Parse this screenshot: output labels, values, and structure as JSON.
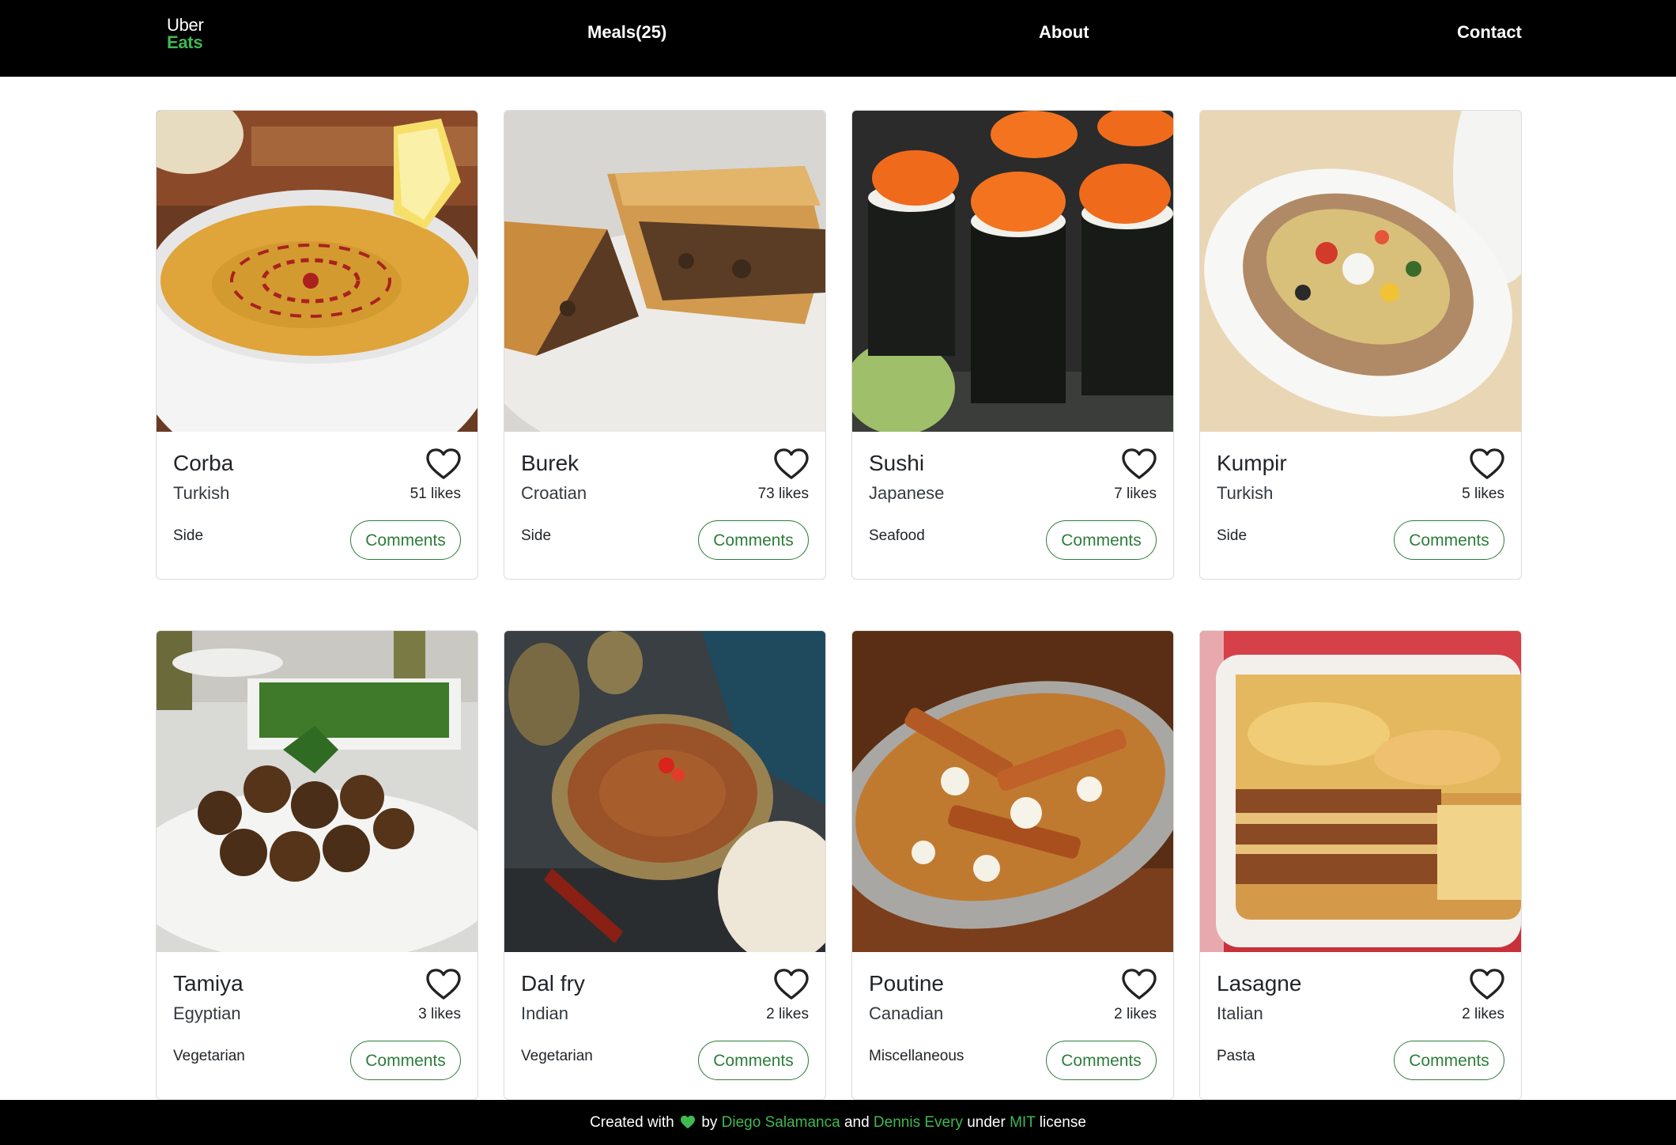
{
  "header": {
    "logo_top": "Uber",
    "logo_bottom": "Eats",
    "nav": {
      "meals": "Meals(25)",
      "about": "About",
      "contact": "Contact"
    }
  },
  "colors": {
    "brand_green": "#3fb950",
    "button_green": "#2e7d3a",
    "navbar_bg": "#000000"
  },
  "meals": [
    {
      "name": "Corba",
      "area": "Turkish",
      "category": "Side",
      "likes": "51 likes",
      "comments_label": "Comments",
      "image": "lentil-soup-in-white-bowl-with-lemon"
    },
    {
      "name": "Burek",
      "area": "Croatian",
      "category": "Side",
      "likes": "73 likes",
      "comments_label": "Comments",
      "image": "meat-filled-pastry-on-plate"
    },
    {
      "name": "Sushi",
      "area": "Japanese",
      "category": "Seafood",
      "likes": "7 likes",
      "comments_label": "Comments",
      "image": "sushi-rolls-with-orange-roe"
    },
    {
      "name": "Kumpir",
      "area": "Turkish",
      "category": "Side",
      "likes": "5 likes",
      "comments_label": "Comments",
      "image": "stuffed-baked-potato"
    },
    {
      "name": "Tamiya",
      "area": "Egyptian",
      "category": "Vegetarian",
      "likes": "3 likes",
      "comments_label": "Comments",
      "image": "falafel-with-salad"
    },
    {
      "name": "Dal fry",
      "area": "Indian",
      "category": "Vegetarian",
      "likes": "2 likes",
      "comments_label": "Comments",
      "image": "lentil-dal-in-brass-bowl-with-naan"
    },
    {
      "name": "Poutine",
      "area": "Canadian",
      "category": "Miscellaneous",
      "likes": "2 likes",
      "comments_label": "Comments",
      "image": "fries-with-gravy-and-cheese-curds"
    },
    {
      "name": "Lasagne",
      "area": "Italian",
      "category": "Pasta",
      "likes": "2 likes",
      "comments_label": "Comments",
      "image": "lasagne-in-baking-dish"
    }
  ],
  "footer": {
    "created_with": "Created with",
    "by": "by",
    "author1": "Diego Salamanca",
    "and": "and",
    "author2": "Dennis Every",
    "under": "under",
    "license_link": "MIT",
    "license_word": "license"
  }
}
